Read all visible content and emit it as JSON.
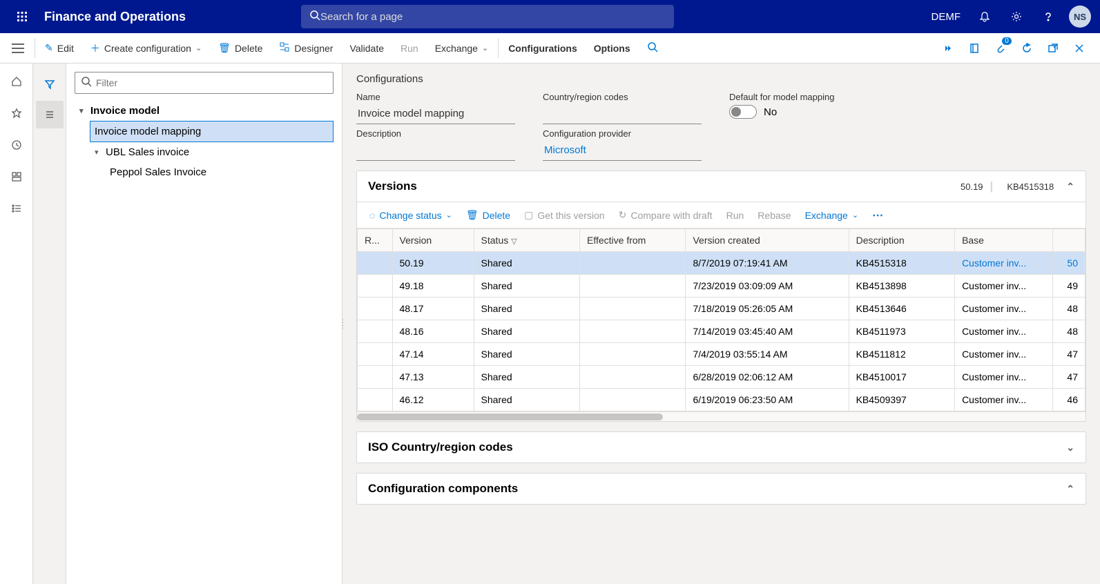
{
  "header": {
    "app_title": "Finance and Operations",
    "search_placeholder": "Search for a page",
    "company": "DEMF",
    "avatar_initials": "NS",
    "attachment_badge": "0"
  },
  "action_bar": {
    "edit": "Edit",
    "create": "Create configuration",
    "delete": "Delete",
    "designer": "Designer",
    "validate": "Validate",
    "run": "Run",
    "exchange": "Exchange",
    "configurations": "Configurations",
    "options": "Options"
  },
  "tree": {
    "filter_placeholder": "Filter",
    "root": "Invoice model",
    "children": [
      "Invoice model mapping",
      "UBL Sales invoice",
      "Peppol Sales Invoice"
    ]
  },
  "details": {
    "section": "Configurations",
    "name_label": "Name",
    "name_value": "Invoice model mapping",
    "country_label": "Country/region codes",
    "country_value": "",
    "default_label": "Default for model mapping",
    "default_value": "No",
    "desc_label": "Description",
    "desc_value": "",
    "provider_label": "Configuration provider",
    "provider_value": "Microsoft"
  },
  "versions": {
    "title": "Versions",
    "summary_version": "50.19",
    "summary_kb": "KB4515318",
    "toolbar": {
      "change_status": "Change status",
      "delete": "Delete",
      "get_version": "Get this version",
      "compare": "Compare with draft",
      "run": "Run",
      "rebase": "Rebase",
      "exchange": "Exchange"
    },
    "columns": [
      "R...",
      "Version",
      "Status",
      "Effective from",
      "Version created",
      "Description",
      "Base",
      ""
    ],
    "rows": [
      {
        "version": "50.19",
        "status": "Shared",
        "effective": "",
        "created": "8/7/2019 07:19:41 AM",
        "desc": "KB4515318",
        "base": "Customer inv...",
        "ext": "50"
      },
      {
        "version": "49.18",
        "status": "Shared",
        "effective": "",
        "created": "7/23/2019 03:09:09 AM",
        "desc": "KB4513898",
        "base": "Customer inv...",
        "ext": "49"
      },
      {
        "version": "48.17",
        "status": "Shared",
        "effective": "",
        "created": "7/18/2019 05:26:05 AM",
        "desc": "KB4513646",
        "base": "Customer inv...",
        "ext": "48"
      },
      {
        "version": "48.16",
        "status": "Shared",
        "effective": "",
        "created": "7/14/2019 03:45:40 AM",
        "desc": "KB4511973",
        "base": "Customer inv...",
        "ext": "48"
      },
      {
        "version": "47.14",
        "status": "Shared",
        "effective": "",
        "created": "7/4/2019 03:55:14 AM",
        "desc": "KB4511812",
        "base": "Customer inv...",
        "ext": "47"
      },
      {
        "version": "47.13",
        "status": "Shared",
        "effective": "",
        "created": "6/28/2019 02:06:12 AM",
        "desc": "KB4510017",
        "base": "Customer inv...",
        "ext": "47"
      },
      {
        "version": "46.12",
        "status": "Shared",
        "effective": "",
        "created": "6/19/2019 06:23:50 AM",
        "desc": "KB4509397",
        "base": "Customer inv...",
        "ext": "46"
      }
    ]
  },
  "iso_section": "ISO Country/region codes",
  "components_section": "Configuration components"
}
